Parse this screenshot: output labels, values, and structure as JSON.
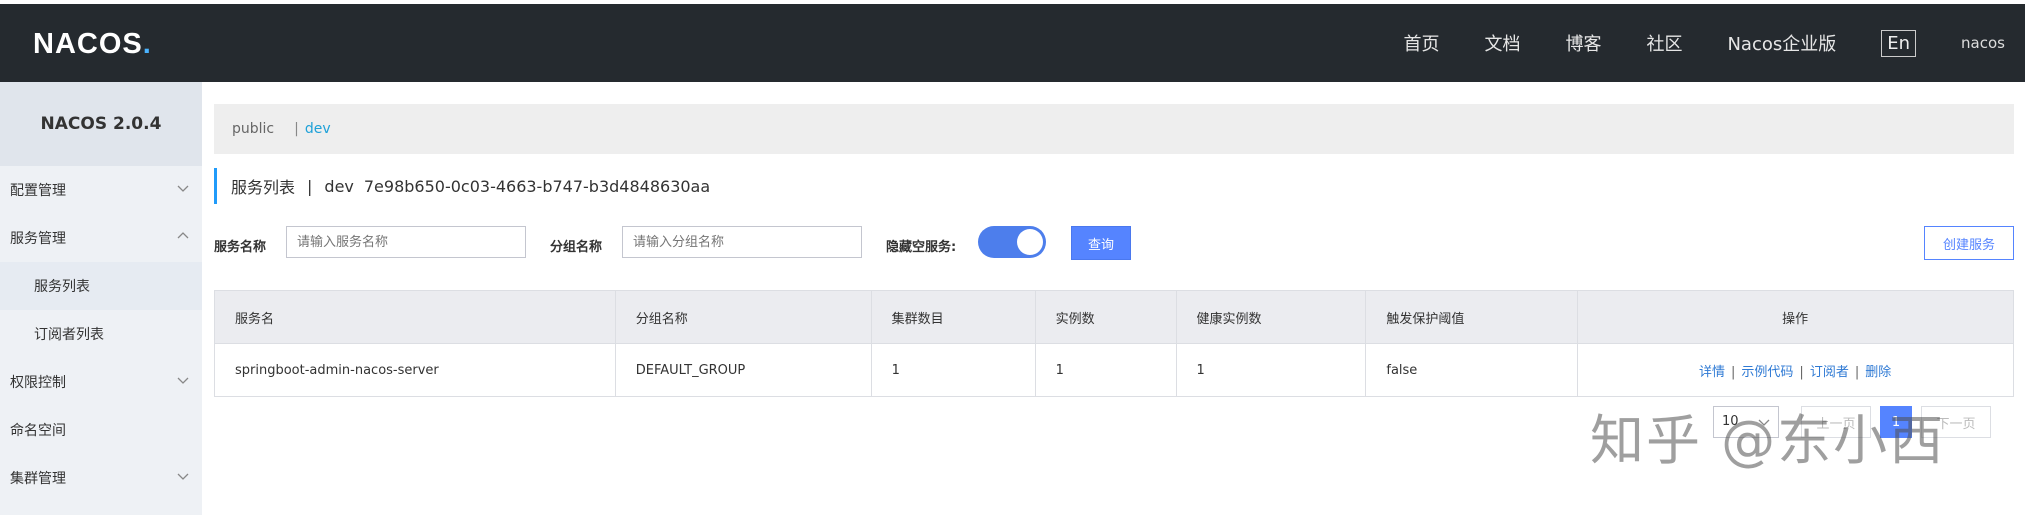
{
  "header": {
    "logo": "NACOS",
    "nav": [
      "首页",
      "文档",
      "博客",
      "社区",
      "Nacos企业版"
    ],
    "lang": "En",
    "user": "nacos"
  },
  "sidebar": {
    "version": "NACOS 2.0.4",
    "items": [
      {
        "label": "配置管理"
      },
      {
        "label": "服务管理"
      },
      {
        "label": "服务列表"
      },
      {
        "label": "订阅者列表"
      },
      {
        "label": "权限控制"
      },
      {
        "label": "命名空间"
      },
      {
        "label": "集群管理"
      }
    ]
  },
  "namespace": {
    "items": [
      "public",
      "dev"
    ],
    "separator": "|"
  },
  "title": {
    "text": "服务列表",
    "sep": "|",
    "ns": "dev",
    "id": "7e98b650-0c03-4663-b747-b3d4848630aa"
  },
  "search": {
    "service_label": "服务名称",
    "service_placeholder": "请输入服务名称",
    "group_label": "分组名称",
    "group_placeholder": "请输入分组名称",
    "hide_empty_label": "隐藏空服务:",
    "hide_empty": true,
    "query": "查询",
    "create": "创建服务"
  },
  "table": {
    "headers": [
      "服务名",
      "分组名称",
      "集群数目",
      "实例数",
      "健康实例数",
      "触发保护阈值",
      "操作"
    ],
    "rows": [
      {
        "name": "springboot-admin-nacos-server",
        "group": "DEFAULT_GROUP",
        "clusters": "1",
        "instances": "1",
        "healthy": "1",
        "threshold": "false"
      }
    ],
    "actions": [
      "详情",
      "示例代码",
      "订阅者",
      "删除"
    ]
  },
  "pager": {
    "size": "10",
    "prev": "上一页",
    "current": "1",
    "next": "下一页"
  },
  "watermark": "知乎 @东小西",
  "colors": {
    "header_bg": "#252a2f",
    "primary": "#5584ff",
    "link": "#2f7ad4",
    "ns_active": "#1ea1d8"
  }
}
